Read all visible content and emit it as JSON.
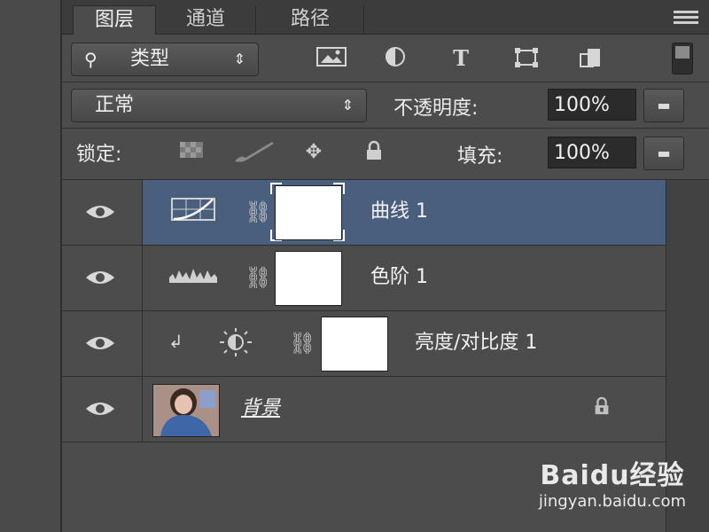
{
  "tabs": [
    {
      "label": "图层",
      "active": true
    },
    {
      "label": "通道",
      "active": false
    },
    {
      "label": "路径",
      "active": false
    }
  ],
  "filter": {
    "kind_label": "类型",
    "icons": [
      "image-filter-icon",
      "adjustment-filter-icon",
      "type-filter-icon",
      "shape-filter-icon",
      "smart-object-filter-icon"
    ]
  },
  "blend": {
    "mode": "正常",
    "opacity_label": "不透明度:",
    "opacity_value": "100%"
  },
  "lock": {
    "label": "锁定:",
    "fill_label": "填充:",
    "fill_value": "100%"
  },
  "layers": [
    {
      "name": "曲线",
      "number": "1",
      "type": "curves",
      "selected": true
    },
    {
      "name": "色阶",
      "number": "1",
      "type": "levels",
      "selected": false
    },
    {
      "name": "亮度/对比度",
      "number": "1",
      "type": "brightness-contrast",
      "clipped": true,
      "selected": false
    },
    {
      "name": "背景",
      "number": "",
      "type": "background",
      "locked": true,
      "selected": false
    }
  ],
  "watermark": {
    "logo": "Baidu经验",
    "url": "jingyan.baidu.com"
  },
  "colors": {
    "panel": "#4c4c4c",
    "selected_row": "#4a5e7e",
    "field": "#2b2b2b"
  }
}
